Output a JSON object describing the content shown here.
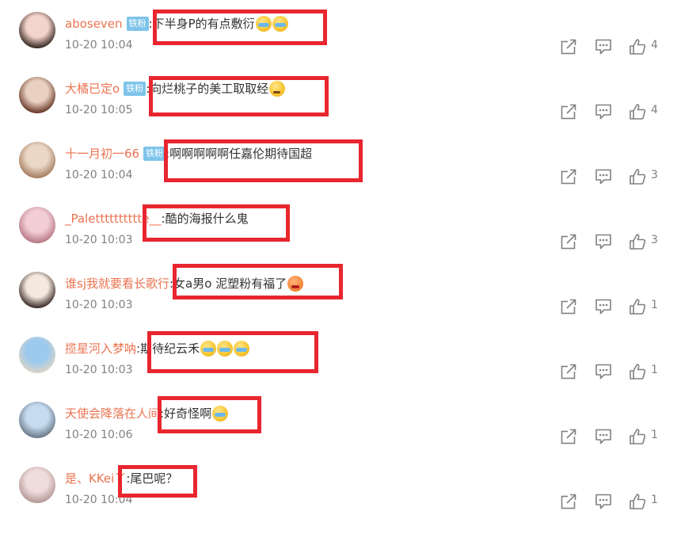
{
  "comments": [
    {
      "user": "aboseven",
      "badge": "铁粉",
      "text": "下半身P的有点敷衍",
      "emojis": [
        "cry",
        "cry"
      ],
      "time": "10-20 10:04",
      "likes": "4",
      "avatar": [
        "#f3d4cc",
        "#3a2a25"
      ]
    },
    {
      "user": "大橘已定o",
      "badge": "铁粉",
      "text": "向烂桃子的美工取取经",
      "emojis": [
        "thinking"
      ],
      "time": "10-20 10:05",
      "likes": "4",
      "avatar": [
        "#e9d0c0",
        "#6a3a2a"
      ]
    },
    {
      "user": "十一月初一66",
      "badge": "铁粉",
      "text": "啊啊啊啊啊任嘉伦期待国超",
      "emojis": [],
      "time": "10-20 10:04",
      "likes": "3",
      "avatar": [
        "#ead7c6",
        "#a67e60"
      ]
    },
    {
      "user": "_Paletttttttttte__",
      "badge": "",
      "text": "酷的海报什么鬼",
      "emojis": [],
      "time": "10-20 10:03",
      "likes": "3",
      "avatar": [
        "#f3cdd5",
        "#b77a85"
      ]
    },
    {
      "user": "谁sj我就要看长歌行",
      "badge": "",
      "text": "女a男o 泥塑粉有福了",
      "emojis": [
        "angry"
      ],
      "time": "10-20 10:03",
      "likes": "1",
      "avatar": [
        "#f5e9df",
        "#3d2d2a"
      ]
    },
    {
      "user": "揽星河入梦呐",
      "badge": "",
      "text": "期待纪云禾",
      "emojis": [
        "cry",
        "cry",
        "cry"
      ],
      "time": "10-20 10:03",
      "likes": "1",
      "avatar": [
        "#9cc9ee",
        "#d9d4c8"
      ]
    },
    {
      "user": "天使会降落在人间",
      "badge": "",
      "text": "好奇怪啊",
      "emojis": [
        "cry"
      ],
      "time": "10-20 10:06",
      "likes": "1",
      "avatar": [
        "#c5dcf0",
        "#6c7a8a"
      ]
    },
    {
      "user": "是、KKei丫",
      "badge": "",
      "text": "尾巴呢？",
      "emojis": [],
      "time": "10-20 10:04",
      "likes": "1",
      "avatar": [
        "#efdcdc",
        "#b59a96"
      ]
    }
  ]
}
